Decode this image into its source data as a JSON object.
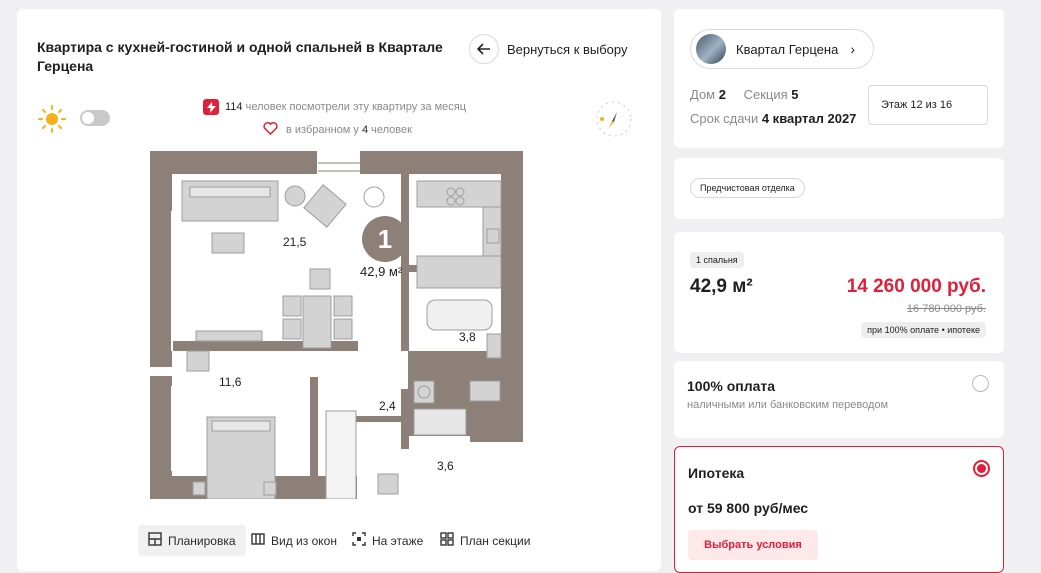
{
  "apartment": {
    "title": "Квартира с кухней-гостиной и одной спальней в Квартале Герцена",
    "back_label": "Вернуться к выбору",
    "views_count": "114",
    "views_text": "человек посмотрели эту квартиру за месяц",
    "favorites_prefix": "в избранном у",
    "favorites_count": "4",
    "favorites_suffix": "человек"
  },
  "plan": {
    "room_number": "1",
    "total_area": "42,9 м²",
    "rooms": {
      "living": "21,5",
      "bedroom": "11,6",
      "hall": "2,4",
      "bath": "3,8",
      "wardrobe": "3,6"
    }
  },
  "tabs": [
    {
      "label": "Планировка",
      "icon": "plan-icon"
    },
    {
      "label": "Вид из окон",
      "icon": "window-icon"
    },
    {
      "label": "На этаже",
      "icon": "floor-icon"
    },
    {
      "label": "План секции",
      "icon": "section-icon"
    }
  ],
  "complex": {
    "name": "Квартал Герцена",
    "house_label": "Дом",
    "house": "2",
    "section_label": "Секция",
    "section": "5",
    "deadline_label": "Срок сдачи",
    "deadline": "4 квартал 2027",
    "floor": "Этаж 12 из 16"
  },
  "finish": {
    "label": "Предчистовая отделка"
  },
  "price": {
    "badge": "1 спальня",
    "area": "42,9 м²",
    "current": "14 260 000 руб.",
    "old": "16 780 000 руб.",
    "note": "при 100% оплате • ипотеке"
  },
  "payment_full": {
    "title": "100% оплата",
    "subtitle": "наличными или банковским переводом"
  },
  "mortgage": {
    "title": "Ипотека",
    "monthly": "от 59 800 руб/мес",
    "button": "Выбрать условия"
  },
  "colors": {
    "accent": "#e0203b",
    "wall": "#8c8078",
    "furniture": "#bdbdbd"
  }
}
